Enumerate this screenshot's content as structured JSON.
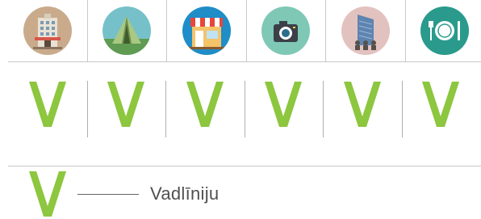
{
  "colors": {
    "check": "#8dc63f",
    "divider": "#c8c8c8",
    "legend_text": "#505050"
  },
  "icons": [
    {
      "name": "hotel-building-icon",
      "bg": "#c9ab8c"
    },
    {
      "name": "camping-tent-icon",
      "bg": "#76c1c9"
    },
    {
      "name": "shop-storefront-icon",
      "bg": "#1f8dc7"
    },
    {
      "name": "camera-icon",
      "bg": "#7fc8b6"
    },
    {
      "name": "office-tower-people-icon",
      "bg": "#e2c2bf"
    },
    {
      "name": "restaurant-plate-cutlery-icon",
      "bg": "#2a9a8c"
    }
  ],
  "checks": [
    "V",
    "V",
    "V",
    "V",
    "V",
    "V"
  ],
  "legend": {
    "symbol": "V",
    "label": "Vadlīniju"
  }
}
